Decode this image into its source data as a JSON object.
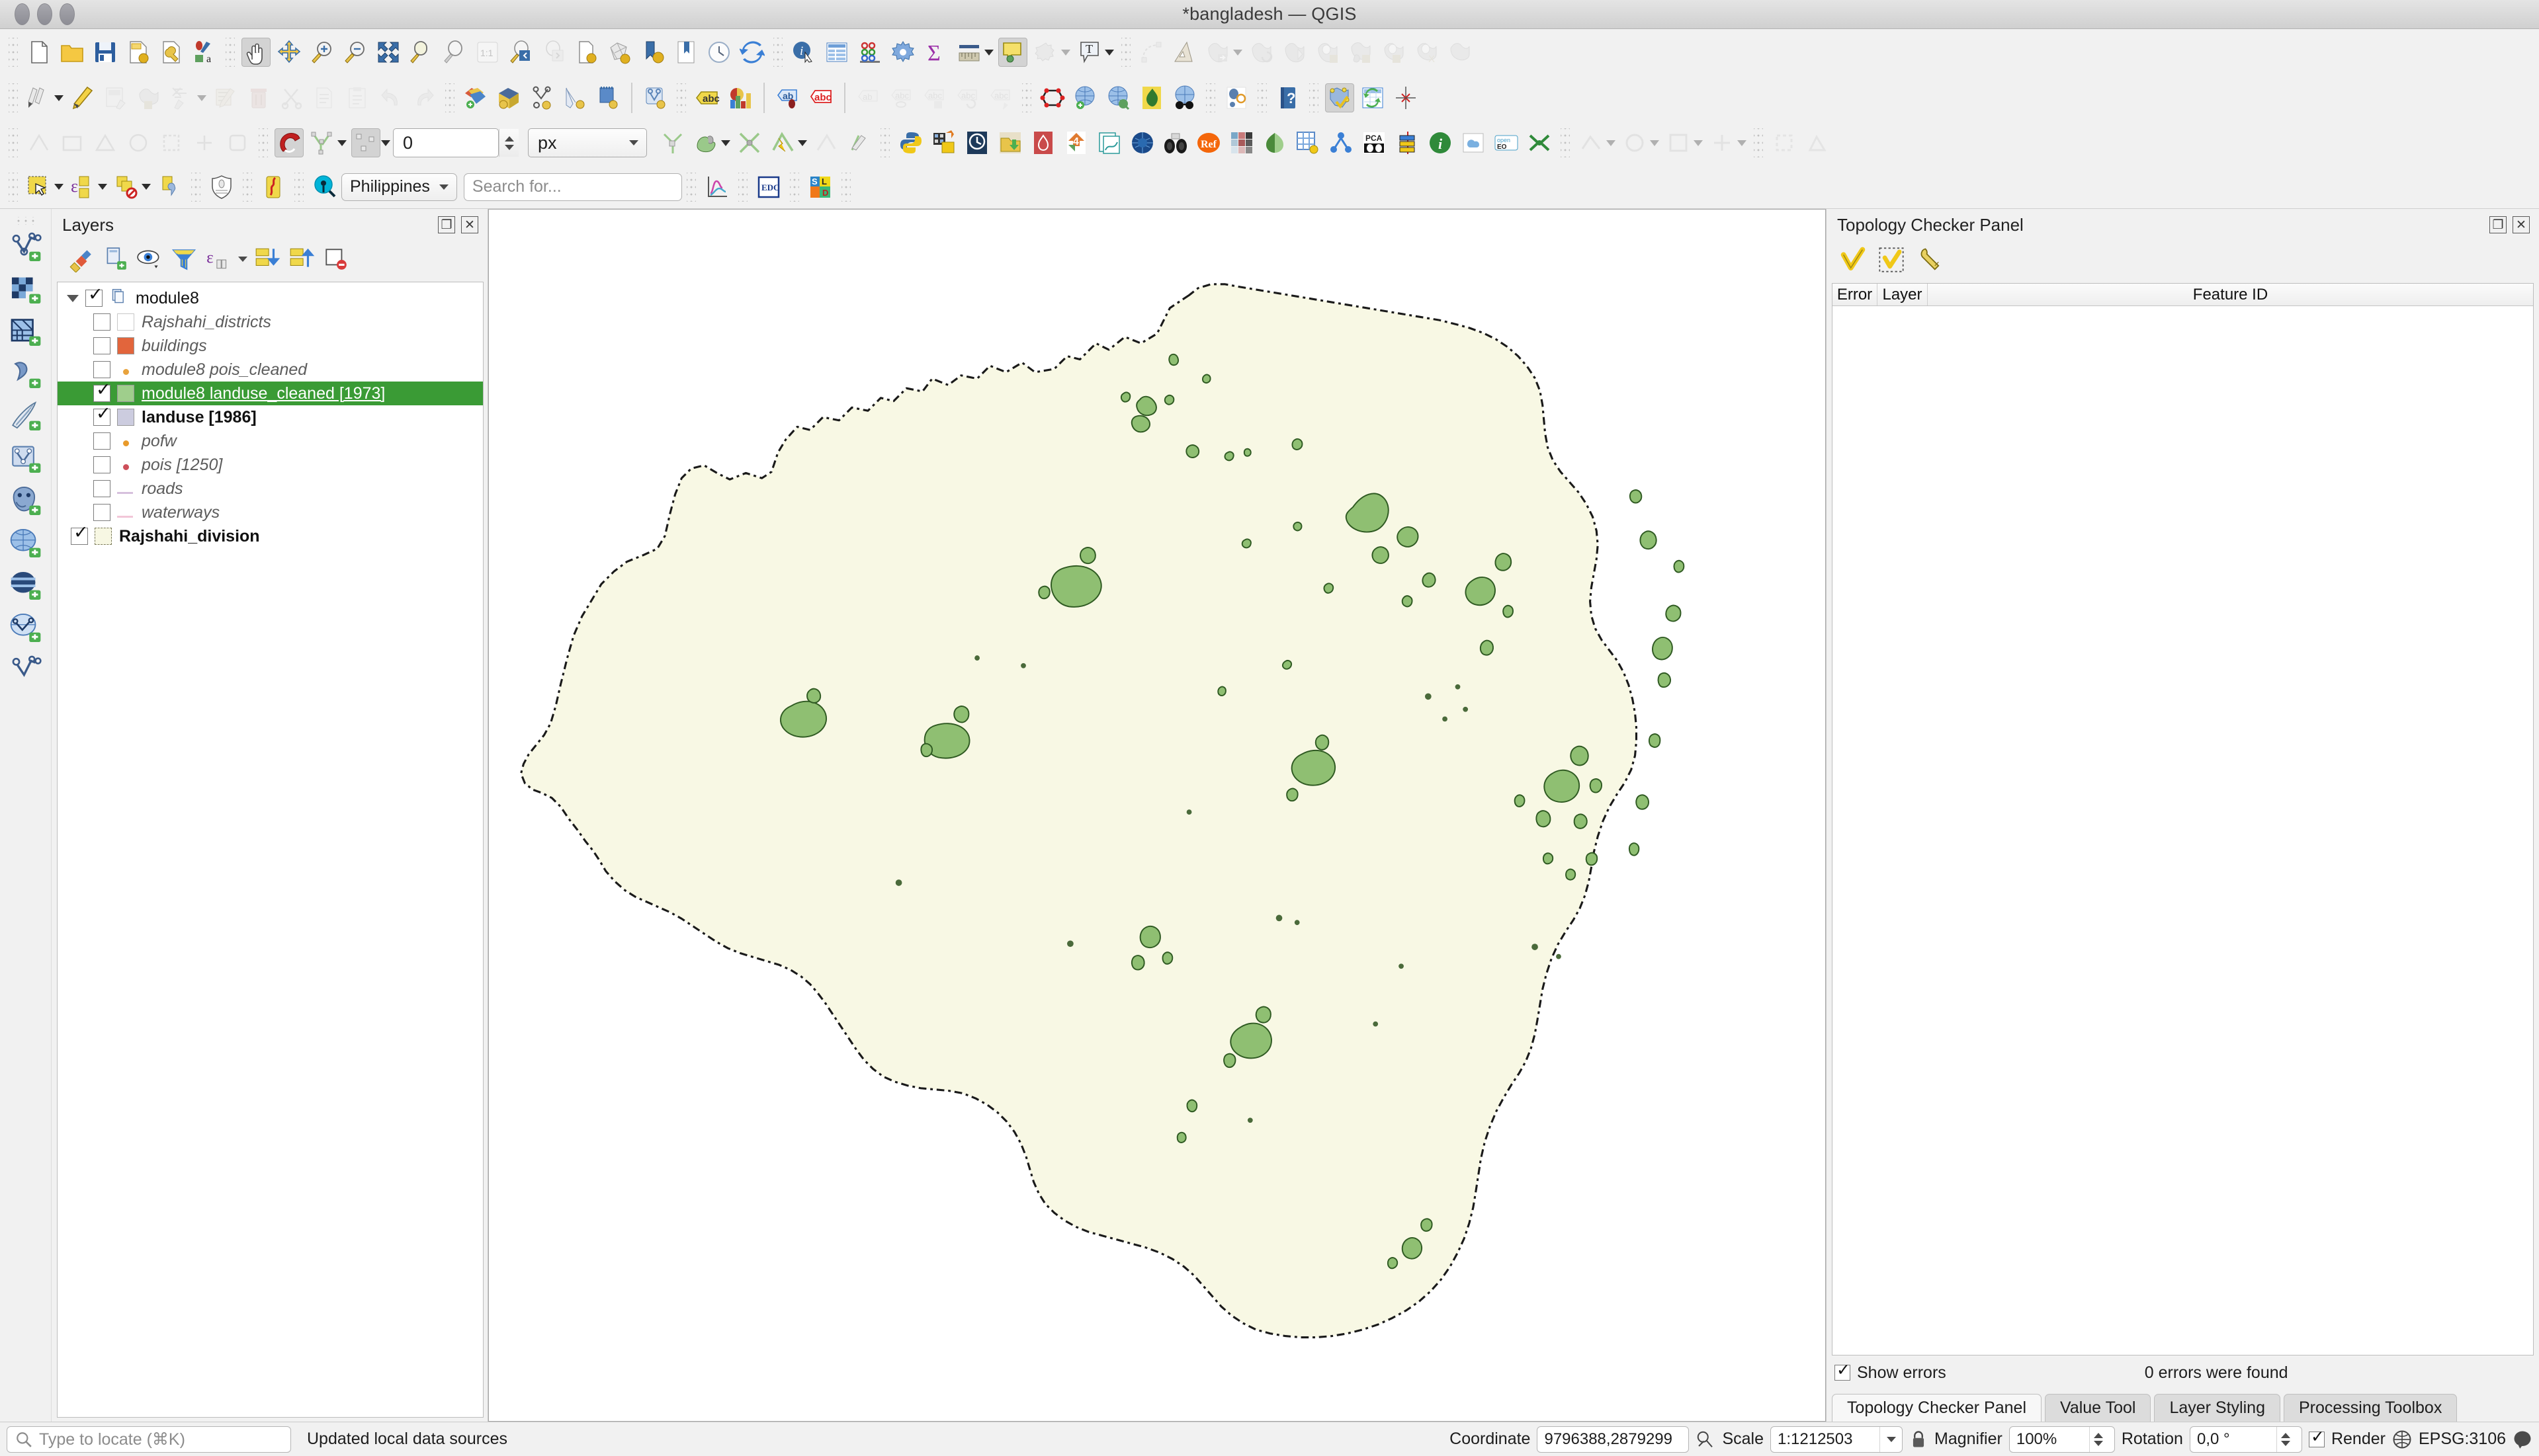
{
  "window": {
    "title": "*bangladesh — QGIS"
  },
  "toolbar_selector": {
    "region_value": "Philippines",
    "search_placeholder": "Search for...",
    "edc_label": "EDC"
  },
  "snapping": {
    "tolerance": "0",
    "units": "px"
  },
  "layers_panel": {
    "title": "Layers",
    "toolbar_icons": [
      "style-manager-icon",
      "add-group-icon",
      "manage-visibility-icon",
      "filter-legend-icon",
      "expression-filter-icon",
      "expand-all-icon",
      "collapse-all-icon",
      "remove-layer-icon"
    ],
    "tree": [
      {
        "name": "module8",
        "type": "group",
        "checked": true,
        "expanded": true,
        "indent": 0,
        "style": "group"
      },
      {
        "name": "Rajshahi_districts",
        "type": "layer",
        "checked": false,
        "indent": 1,
        "symbol": "polygon",
        "color": "#ffffff"
      },
      {
        "name": "buildings",
        "type": "layer",
        "checked": false,
        "indent": 1,
        "symbol": "polygon",
        "color": "#e2653c"
      },
      {
        "name": "module8 pois_cleaned",
        "type": "layer",
        "checked": false,
        "indent": 1,
        "symbol": "point",
        "color": "#e8a33d"
      },
      {
        "name": "module8 landuse_cleaned [1973]",
        "type": "layer",
        "checked": true,
        "indent": 1,
        "symbol": "polygon",
        "color": "#9fce8c",
        "selected": true
      },
      {
        "name": "landuse [1986]",
        "type": "layer",
        "checked": true,
        "indent": 1,
        "symbol": "polygon",
        "color": "#ccccdf",
        "bold": true
      },
      {
        "name": "pofw",
        "type": "layer",
        "checked": false,
        "indent": 1,
        "symbol": "point",
        "color": "#e89a2a"
      },
      {
        "name": "pois [1250]",
        "type": "layer",
        "checked": false,
        "indent": 1,
        "symbol": "point",
        "color": "#cd4f5a"
      },
      {
        "name": "roads",
        "type": "layer",
        "checked": false,
        "indent": 1,
        "symbol": "line",
        "color": "#d6c0dd"
      },
      {
        "name": "waterways",
        "type": "layer",
        "checked": false,
        "indent": 1,
        "symbol": "line",
        "color": "#f2c6d8"
      },
      {
        "name": "Rajshahi_division",
        "type": "layer",
        "checked": true,
        "indent": 0,
        "symbol": "polygon-dashed",
        "color": "#f7f7e3",
        "bold": true
      }
    ]
  },
  "topology_panel": {
    "title": "Topology Checker Panel",
    "toolbar_icons": [
      "validate-all-icon",
      "validate-extent-icon",
      "configure-icon"
    ],
    "columns": [
      "Error",
      "Layer",
      "Feature ID"
    ],
    "rows": [],
    "show_errors_label": "Show errors",
    "show_errors_checked": true,
    "result_message": "0 errors were found"
  },
  "bottom_tabs": [
    {
      "label": "Topology Checker Panel",
      "active": true
    },
    {
      "label": "Value Tool",
      "active": false
    },
    {
      "label": "Layer Styling",
      "active": false
    },
    {
      "label": "Processing Toolbox",
      "active": false
    }
  ],
  "statusbar": {
    "locate_placeholder": "Type to locate (⌘K)",
    "message": "Updated local data sources",
    "coordinate_label": "Coordinate",
    "coordinate_value": "9796388,2879299",
    "scale_label": "Scale",
    "scale_value": "1:1212503",
    "magnifier_label": "Magnifier",
    "magnifier_value": "100%",
    "rotation_label": "Rotation",
    "rotation_value": "0,0 °",
    "render_label": "Render",
    "render_checked": true,
    "crs_label": "EPSG:3106"
  },
  "map": {
    "background": "#ffffff",
    "region_fill": "#f8f8e4",
    "region_stroke": "#1a1a1a",
    "landuse_fill": "#8fbf72",
    "landuse_stroke": "#2f5a22"
  }
}
